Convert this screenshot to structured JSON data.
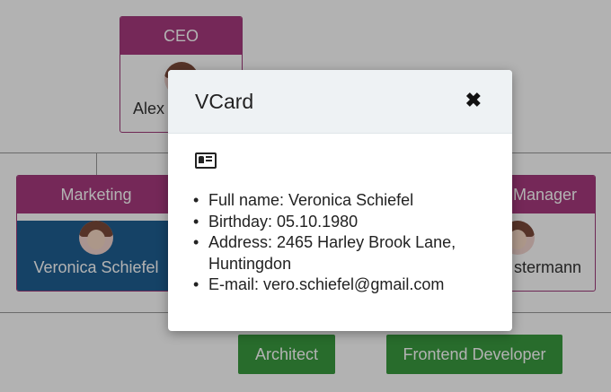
{
  "org_chart": {
    "ceo": {
      "title": "CEO",
      "name": "Alex"
    },
    "marketing": {
      "title": "Marketing",
      "name": "Veronica Schiefel"
    },
    "manager": {
      "title": "Manager",
      "name": "stermann"
    },
    "buttons": [
      "Architect",
      "Frontend Developer"
    ]
  },
  "modal": {
    "title": "VCard",
    "close_glyph": "✖",
    "icon": "vcard-icon",
    "fields": [
      "Full name: Veronica Schiefel",
      "Birthday: 05.10.1980",
      "Address: 2465 Harley Brook Lane, Huntingdon",
      "E-mail: vero.schiefel@gmail.com"
    ]
  },
  "colors": {
    "node_header": "#a83a7e",
    "selected_node": "#1f5f93",
    "button_green": "#3a9b3f",
    "modal_header": "#eef2f4"
  }
}
